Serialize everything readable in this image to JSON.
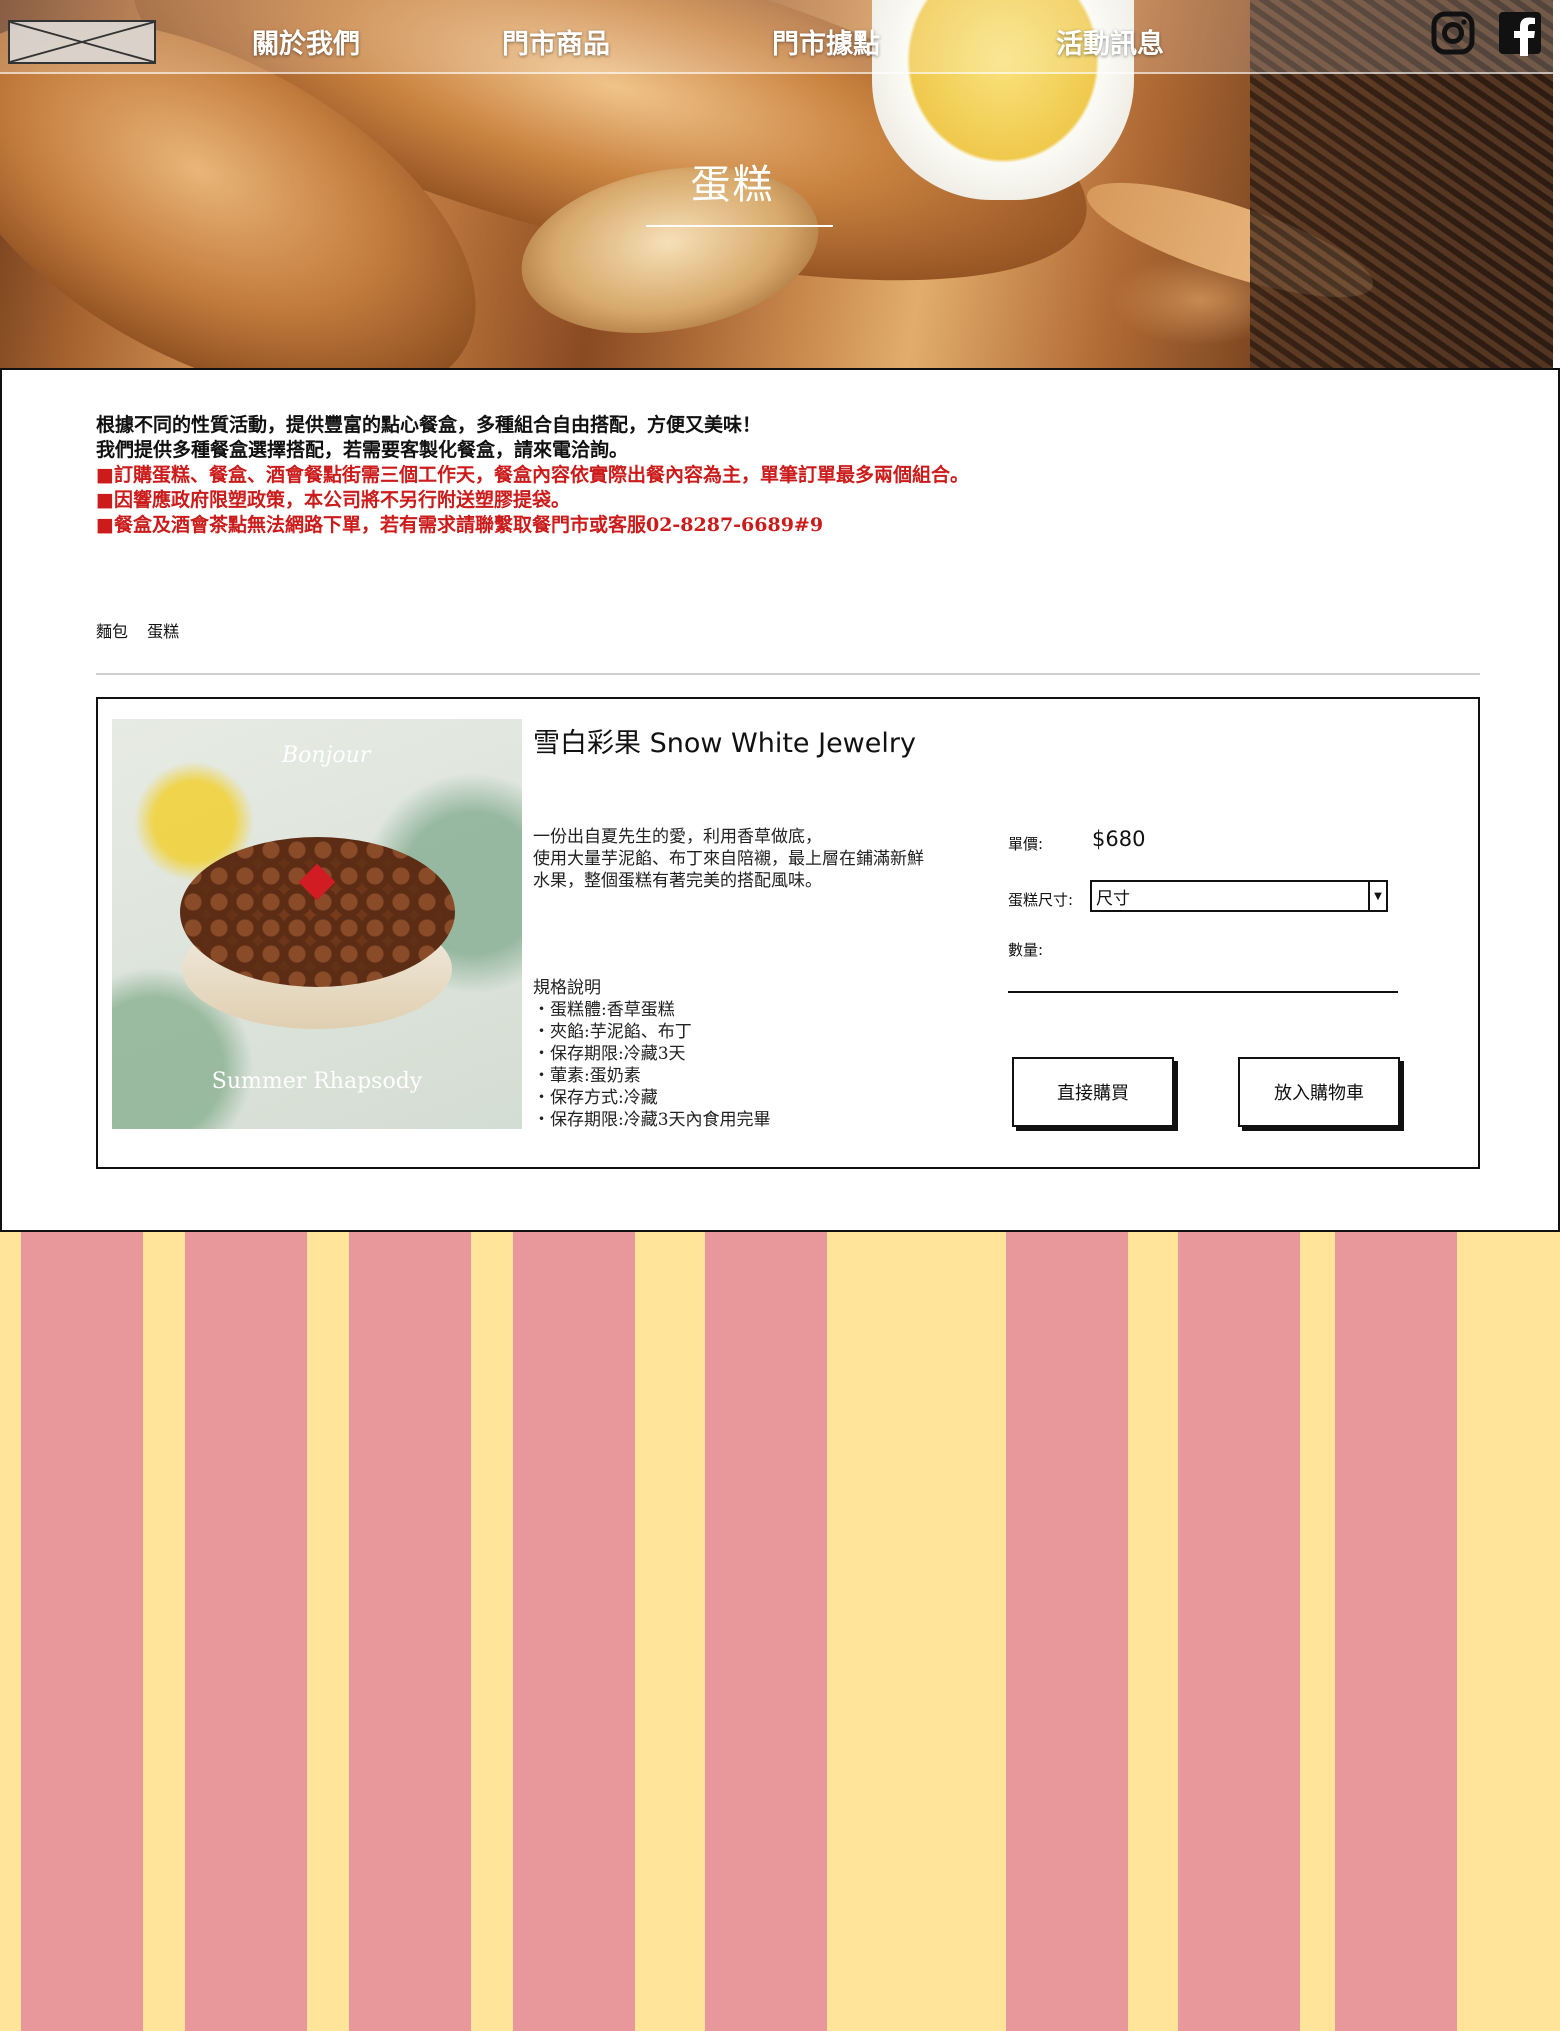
{
  "nav": {
    "items": [
      "關於我們",
      "門市商品",
      "門市據點",
      "活動訊息"
    ],
    "social": [
      "instagram-icon",
      "facebook-icon"
    ]
  },
  "hero": {
    "title": "蛋糕"
  },
  "intro": {
    "line1": "根據不同的性質活動，提供豐富的點心餐盒，多種組合自由搭配，方便又美味！",
    "line2": "我們提供多種餐盒選擇搭配，若需要客製化餐盒，請來電洽詢。",
    "notice1": "■訂購蛋糕、餐盒、酒會餐點街需三個工作天，餐盒內容依實際出餐內容為主，單筆訂單最多兩個組合。",
    "notice2": "■因響應政府限塑政策，本公司將不另行附送塑膠提袋。",
    "notice3": "■餐盒及酒會茶點無法網路下單，若有需求請聯繫取餐門市或客服02-8287-6689#9"
  },
  "categories": [
    "麵包",
    "蛋糕"
  ],
  "product": {
    "title": "雪白彩果 Snow White Jewelry",
    "image_brand": "Bonjour",
    "image_subtitle": "Summer Rhapsody",
    "description": [
      " 一份出自夏先生的愛，利用香草做底，",
      "使用大量芋泥餡、布丁來自陪襯，最上層在鋪滿新鮮",
      "水果，整個蛋糕有著完美的搭配風味。"
    ],
    "spec_title": "規格說明",
    "specs": [
      "・蛋糕體:香草蛋糕",
      "・夾餡:芋泥餡、布丁",
      "・保存期限:冷藏3天",
      "・葷素:蛋奶素",
      "・保存方式:冷藏",
      "・保存期限:冷藏3天內食用完畢"
    ],
    "price_label": "單價:",
    "price": "$680",
    "size_label": "蛋糕尺寸:",
    "size_value": "尺寸",
    "qty_label": "數量:",
    "buy_now": "直接購買",
    "add_to_cart": "放入購物車"
  },
  "colors": {
    "stripe_pink": "#e8979a",
    "stripe_yellow": "#ffe499",
    "notice_red": "#cc1b1b"
  }
}
